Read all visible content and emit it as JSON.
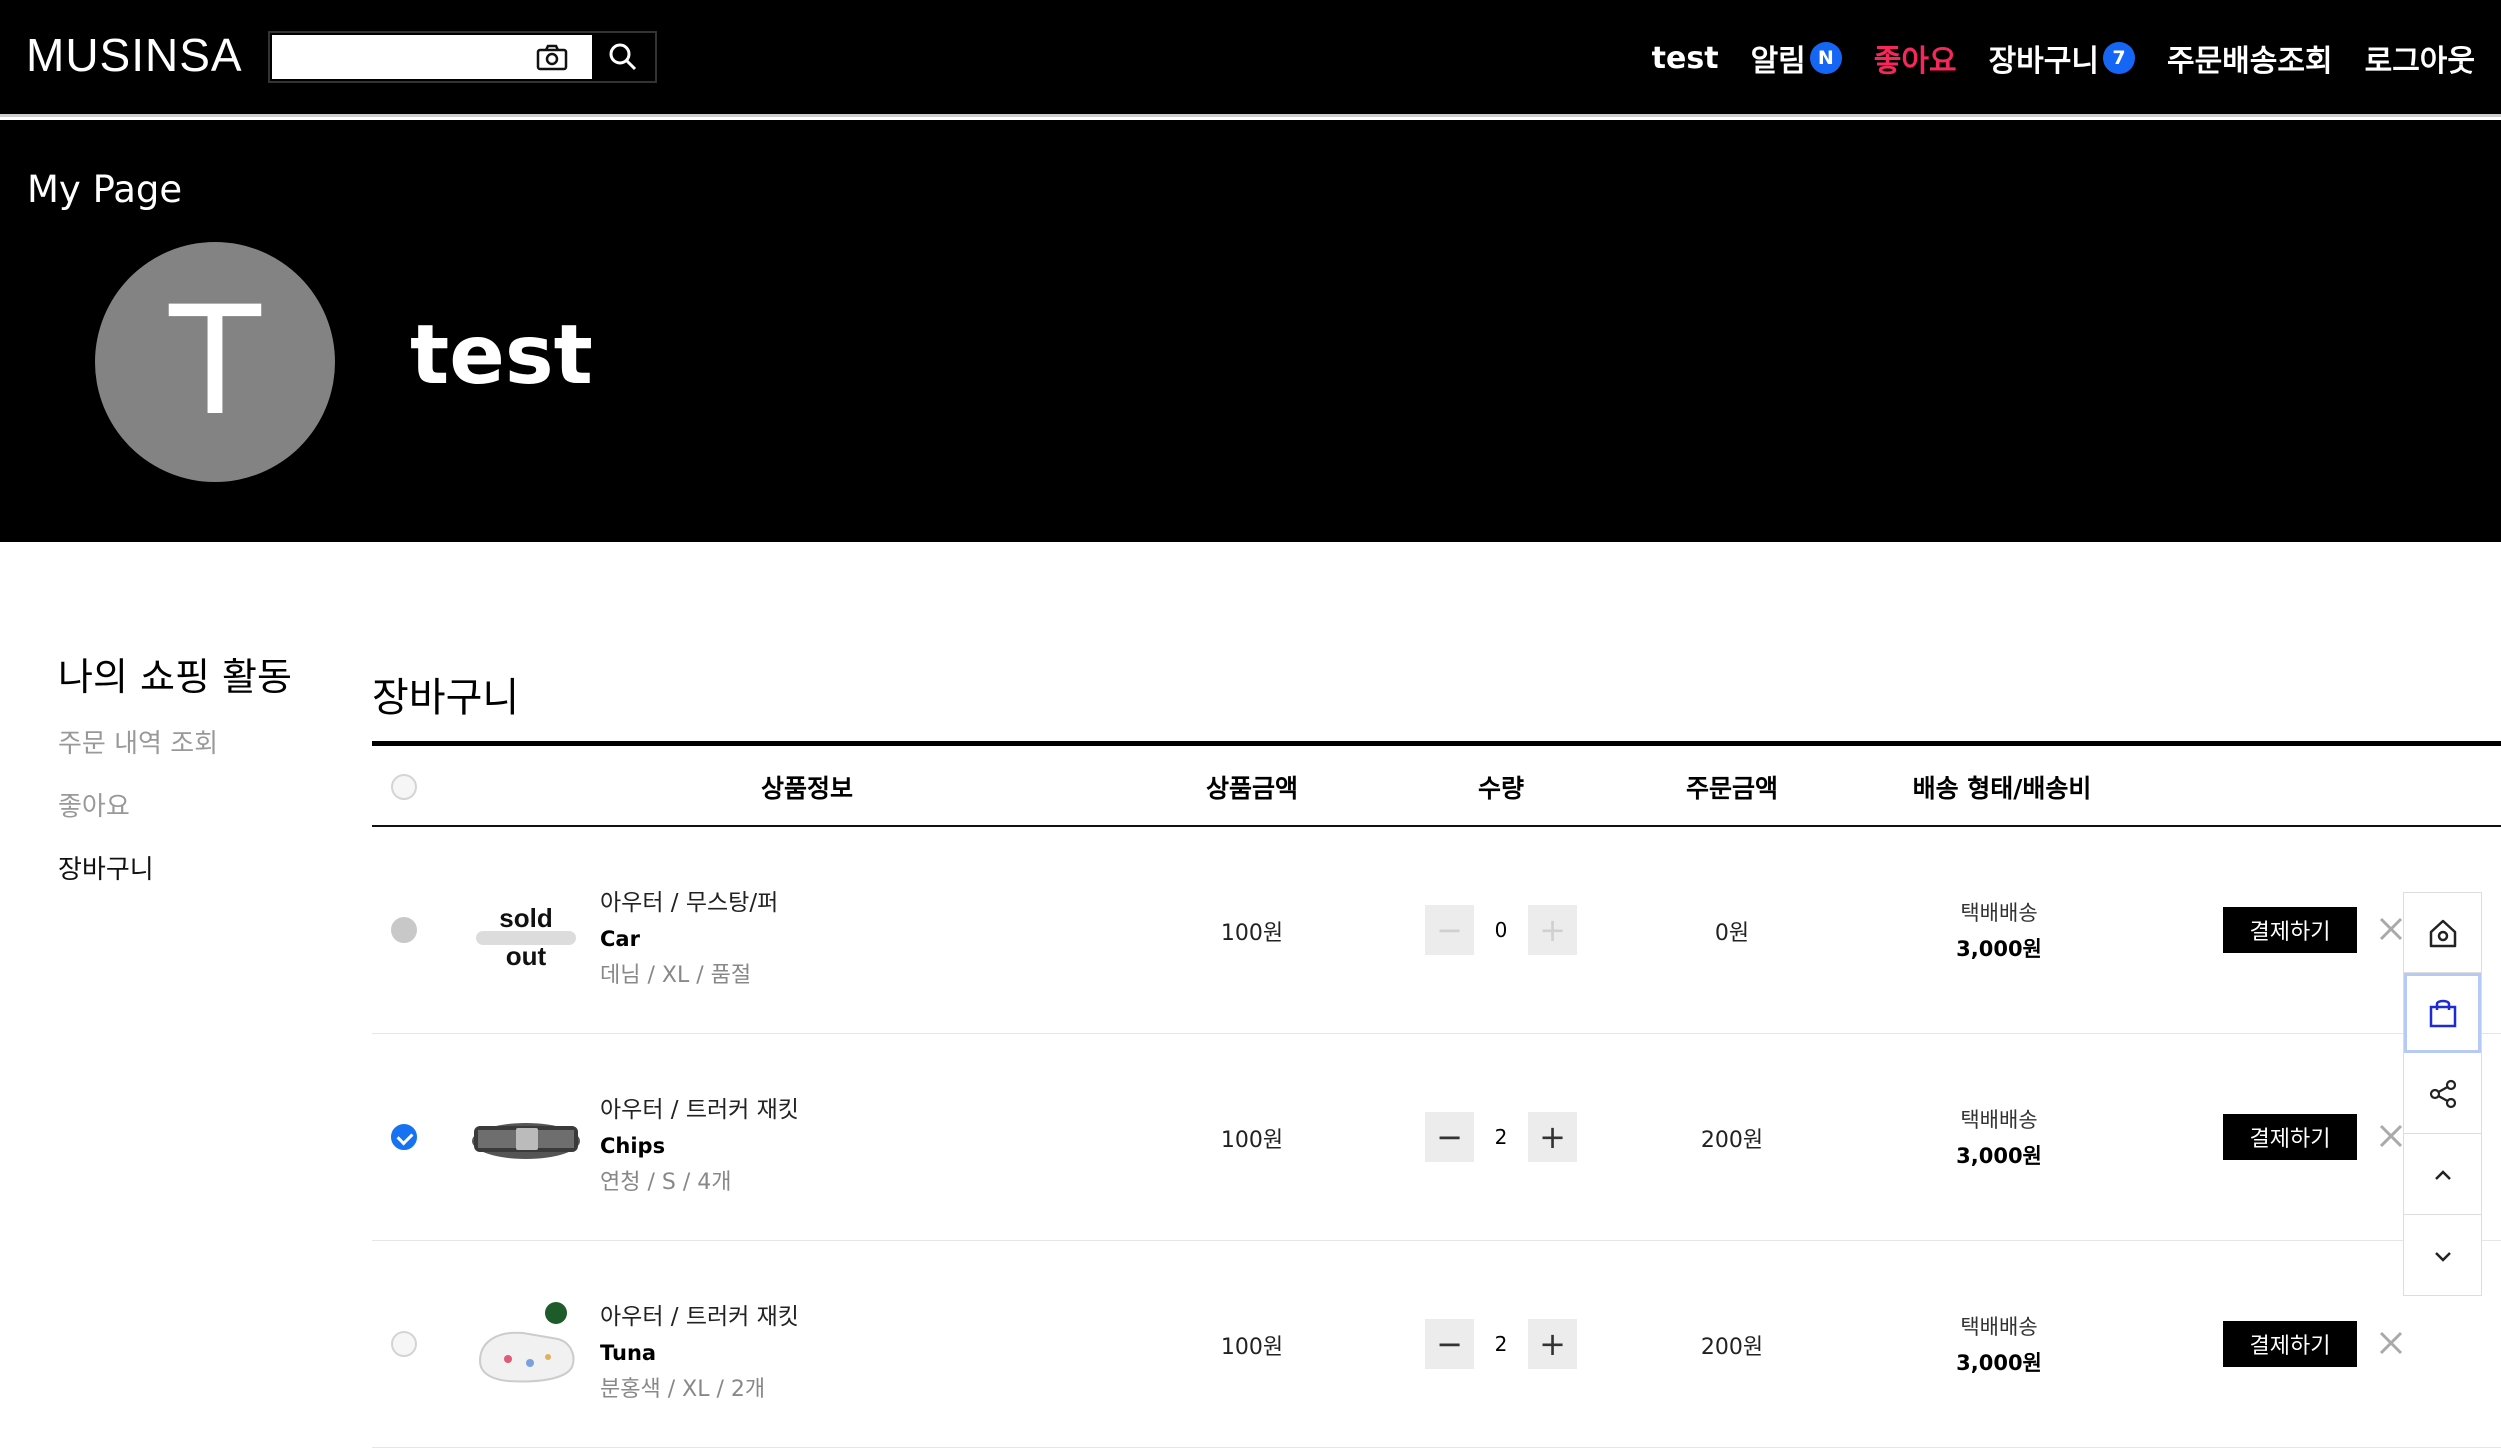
{
  "header": {
    "logo": "MUSINSA",
    "search_placeholder": "",
    "nav": {
      "user": "test",
      "alarm": "알림",
      "alarm_badge": "N",
      "like": "좋아요",
      "cart": "장바구니",
      "cart_badge": "7",
      "orders": "주문배송조회",
      "logout": "로그아웃"
    }
  },
  "hero": {
    "title": "My Page",
    "avatar_letter": "T",
    "username": "test"
  },
  "sidebar": {
    "title": "나의 쇼핑 활동",
    "items": [
      {
        "label": "주문 내역 조회"
      },
      {
        "label": "좋아요"
      },
      {
        "label": "장바구니"
      }
    ]
  },
  "cart": {
    "title": "장바구니",
    "columns": [
      "상품정보",
      "상품금액",
      "수량",
      "주문금액",
      "배송 형태/배송비"
    ],
    "rows": [
      {
        "category": "아우터 / 무스탕/퍼",
        "name": "Car",
        "option": "데님 / XL / 품절",
        "price": "100원",
        "qty": "0",
        "total": "0원",
        "ship_type": "택배배송",
        "ship_fee": "3,000원",
        "pay_label": "결제하기",
        "soldout": true,
        "soldout_text_1": "sold",
        "soldout_text_2": "out"
      },
      {
        "category": "아우터 / 트러커 재킷",
        "name": "Chips",
        "option": "연청 / S / 4개",
        "price": "100원",
        "qty": "2",
        "total": "200원",
        "ship_type": "택배배송",
        "ship_fee": "3,000원",
        "pay_label": "결제하기"
      },
      {
        "category": "아우터 / 트러커 재킷",
        "name": "Tuna",
        "option": "분홍색 / XL / 2개",
        "price": "100원",
        "qty": "2",
        "total": "200원",
        "ship_type": "택배배송",
        "ship_fee": "3,000원",
        "pay_label": "결제하기"
      }
    ]
  },
  "colors": {
    "accent_blue": "#1672f3",
    "like_pink": "#f5275b"
  },
  "quick_menu": [
    "home-icon",
    "shopping-bag-icon",
    "share-icon",
    "chevron-up-icon",
    "chevron-down-icon"
  ]
}
